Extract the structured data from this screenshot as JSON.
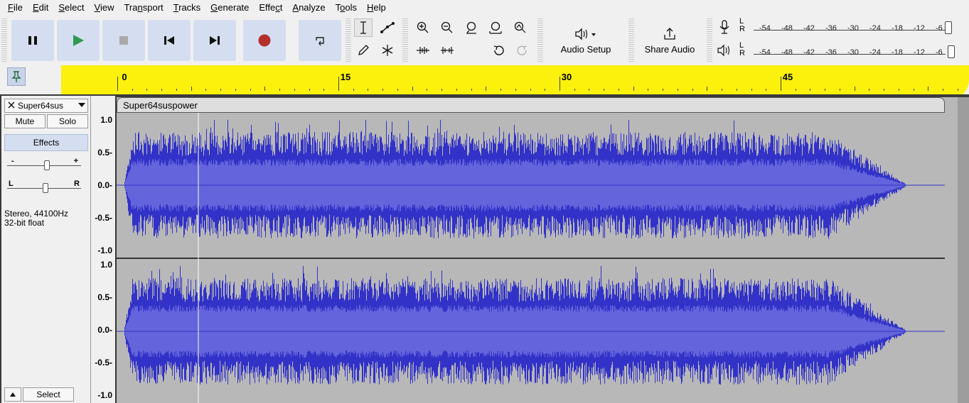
{
  "menu": [
    {
      "label": "File",
      "accel": "F"
    },
    {
      "label": "Edit",
      "accel": "E"
    },
    {
      "label": "Select",
      "accel": "S"
    },
    {
      "label": "View",
      "accel": "V"
    },
    {
      "label": "Transport",
      "accel": "n"
    },
    {
      "label": "Tracks",
      "accel": "T"
    },
    {
      "label": "Generate",
      "accel": "G"
    },
    {
      "label": "Effect",
      "accel": "c"
    },
    {
      "label": "Analyze",
      "accel": "A"
    },
    {
      "label": "Tools",
      "accel": "o"
    },
    {
      "label": "Help",
      "accel": "H"
    }
  ],
  "toolbar": {
    "audio_setup_label": "Audio Setup",
    "share_audio_label": "Share Audio",
    "meter_ticks": [
      "-54",
      "-48",
      "-42",
      "-36",
      "-30",
      "-24",
      "-18",
      "-12",
      "-6"
    ],
    "meter_L": "L",
    "meter_R": "R"
  },
  "ruler": {
    "labels": [
      "0",
      "15",
      "30",
      "45"
    ],
    "values": [
      0,
      15,
      30,
      45
    ]
  },
  "track": {
    "name": "Super64sus",
    "mute_label": "Mute",
    "solo_label": "Solo",
    "effects_label": "Effects",
    "gain_minus": "-",
    "gain_plus": "+",
    "pan_left": "L",
    "pan_right": "R",
    "info_line1": "Stereo, 44100Hz",
    "info_line2": "32-bit float",
    "select_label": "Select",
    "clip_name": "Super64suspower",
    "scale_labels": [
      "1.0",
      "0.5-",
      "0.0-",
      "-0.5-",
      "-1.0"
    ]
  },
  "colors": {
    "accent_button": "#d5def0",
    "waveform_outer": "#3232c8",
    "waveform_inner": "#6464dc",
    "clip_background": "#b8b8b8",
    "record_red": "#b4302c",
    "play_green": "#2e9a50",
    "highlight_yellow": "#fbf000"
  }
}
